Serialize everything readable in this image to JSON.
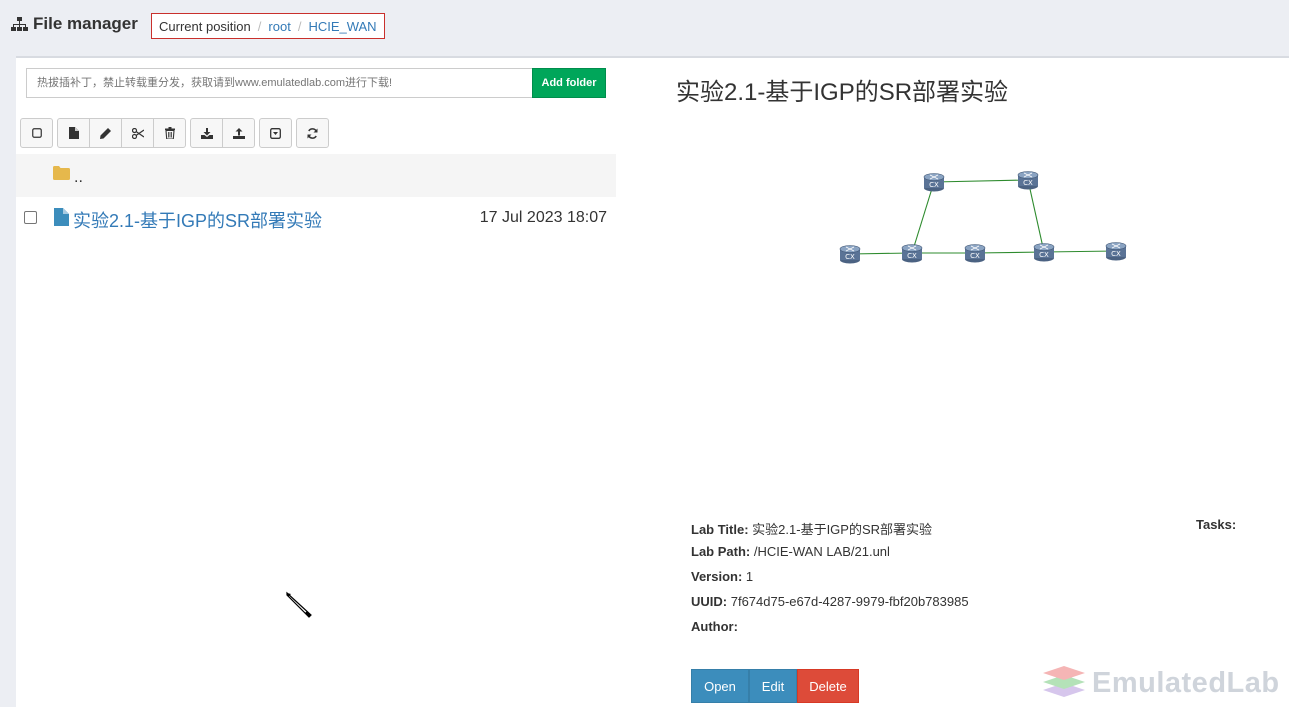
{
  "header": {
    "title": "File manager",
    "breadcrumb": {
      "label": "Current position",
      "items": [
        "root",
        "HCIE_WAN"
      ]
    }
  },
  "folder_form": {
    "placeholder": "热拔插补丁，禁止转载重分发，获取请到www.emulatedlab.com进行下载!",
    "add_button": "Add folder"
  },
  "toolbar": {
    "icons": [
      "checkbox-icon",
      "new-file-icon",
      "pencil-icon",
      "scissors-icon",
      "trash-icon",
      "download-icon",
      "upload-icon",
      "import-icon",
      "refresh-icon"
    ]
  },
  "file_list": {
    "parent_label": "..",
    "items": [
      {
        "name": "实验2.1-基于IGP的SR部署实验",
        "date": "17 Jul 2023 18:07"
      }
    ]
  },
  "preview": {
    "heading": "实验2.1-基于IGP的SR部署实验",
    "topology_node_label": "CX",
    "info": {
      "title_label": "Lab Title:",
      "title_value": "实验2.1-基于IGP的SR部署实验",
      "path_label": "Lab Path:",
      "path_value": "/HCIE-WAN LAB/21.unl",
      "version_label": "Version:",
      "version_value": "1",
      "uuid_label": "UUID:",
      "uuid_value": "7f674d75-e67d-4287-9979-fbf20b783985",
      "author_label": "Author:",
      "author_value": ""
    },
    "tasks_label": "Tasks:",
    "buttons": {
      "open": "Open",
      "edit": "Edit",
      "delete": "Delete"
    }
  },
  "watermark": {
    "text": "EmulatedLab"
  },
  "colors": {
    "accent_blue": "#3c8dbc",
    "link_blue": "#337ab7",
    "success_green": "#00a65a",
    "danger_red": "#dd4b39",
    "breadcrumb_border": "#c9302c",
    "link_line_green": "#2e8b2e"
  }
}
